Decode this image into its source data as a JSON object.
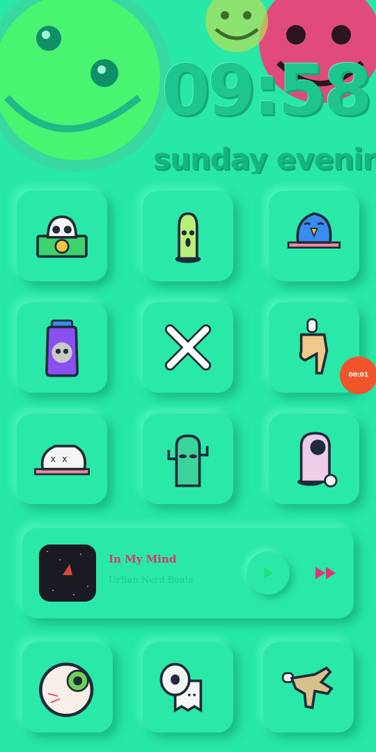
{
  "clock": {
    "time": "09:58",
    "day_text": "sunday evening"
  },
  "colors": {
    "background": "#27e8a6",
    "accent_pink": "#d9366a",
    "timer": "#f0542a",
    "play": "#22e07a"
  },
  "apps": [
    {
      "name": "skull-money-icon"
    },
    {
      "name": "condom-icon"
    },
    {
      "name": "blue-bird-icon"
    },
    {
      "name": "skull-jar-icon"
    },
    {
      "name": "crossbones-icon"
    },
    {
      "name": "pointing-hand-icon"
    },
    {
      "name": "dead-cat-icon"
    },
    {
      "name": "cactus-icon"
    },
    {
      "name": "eyeball-creature-icon"
    },
    {
      "name": "eyeball-icon"
    },
    {
      "name": "toilet-paper-icon"
    },
    {
      "name": "rock-hand-icon"
    }
  ],
  "music": {
    "title": "In My Mind",
    "artist": "UrBan Nerd Beats",
    "play_icon": "play-icon",
    "next_icon": "fast-forward-icon"
  },
  "timer": {
    "label": "00:01"
  }
}
